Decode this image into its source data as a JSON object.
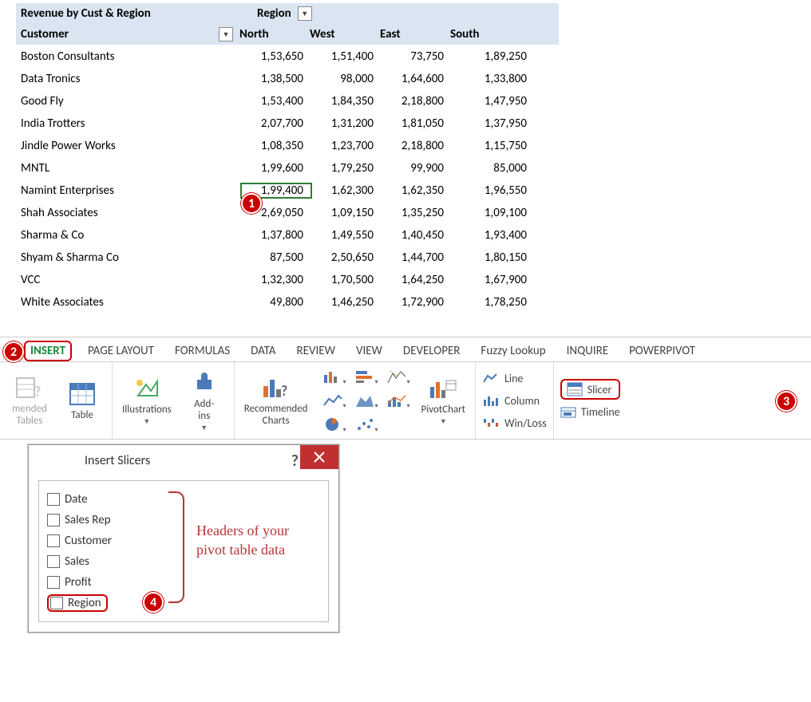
{
  "pivot": {
    "title": "Revenue by Cust & Region",
    "region_label": "Region",
    "customer_label": "Customer",
    "columns": [
      "North",
      "West",
      "East",
      "South"
    ],
    "rows": [
      {
        "name": "Boston Consultants",
        "vals": [
          "1,53,650",
          "1,51,400",
          "73,750",
          "1,89,250"
        ]
      },
      {
        "name": "Data Tronics",
        "vals": [
          "1,38,500",
          "98,000",
          "1,64,600",
          "1,33,800"
        ]
      },
      {
        "name": "Good Fly",
        "vals": [
          "1,53,400",
          "1,84,350",
          "2,18,800",
          "1,47,950"
        ]
      },
      {
        "name": "India Trotters",
        "vals": [
          "2,07,700",
          "1,31,200",
          "1,81,050",
          "1,37,950"
        ]
      },
      {
        "name": "Jindle Power Works",
        "vals": [
          "1,08,350",
          "1,23,700",
          "2,18,800",
          "1,15,750"
        ]
      },
      {
        "name": "MNTL",
        "vals": [
          "1,99,600",
          "1,79,250",
          "99,900",
          "85,000"
        ]
      },
      {
        "name": "Namint Enterprises",
        "vals": [
          "1,99,400",
          "1,62,300",
          "1,62,350",
          "1,96,550"
        ],
        "selected": 0
      },
      {
        "name": "Shah Associates",
        "vals": [
          "2,69,050",
          "1,09,150",
          "1,35,250",
          "1,09,100"
        ]
      },
      {
        "name": "Sharma & Co",
        "vals": [
          "1,37,800",
          "1,49,550",
          "1,40,450",
          "1,93,400"
        ]
      },
      {
        "name": "Shyam & Sharma Co",
        "vals": [
          "87,500",
          "2,50,650",
          "1,44,700",
          "1,80,150"
        ]
      },
      {
        "name": "VCC",
        "vals": [
          "1,32,300",
          "1,70,500",
          "1,64,250",
          "1,67,900"
        ]
      },
      {
        "name": "White Associates",
        "vals": [
          "49,800",
          "1,46,250",
          "1,72,900",
          "1,78,250"
        ]
      }
    ]
  },
  "ribbon": {
    "tabs": [
      "INSERT",
      "PAGE LAYOUT",
      "FORMULAS",
      "DATA",
      "REVIEW",
      "VIEW",
      "DEVELOPER",
      "Fuzzy Lookup",
      "INQUIRE",
      "POWERPIVOT"
    ],
    "active_tab": "INSERT",
    "buttons": {
      "recommended_tables": "mended\nTables",
      "table": "Table",
      "illustrations": "Illustrations",
      "addins": "Add-\nins",
      "recommended_charts": "Recommended\nCharts",
      "pivotchart": "PivotChart"
    },
    "spark": {
      "line": "Line",
      "column": "Column",
      "winloss": "Win/Loss"
    },
    "filters": {
      "slicer": "Slicer",
      "timeline": "Timeline"
    }
  },
  "dialog": {
    "title": "Insert Slicers",
    "fields": [
      "Date",
      "Sales Rep",
      "Customer",
      "Sales",
      "Profit",
      "Region"
    ],
    "annotation": "Headers of your\npivot table data"
  },
  "callouts": {
    "c1": "1",
    "c2": "2",
    "c3": "3",
    "c4": "4"
  }
}
